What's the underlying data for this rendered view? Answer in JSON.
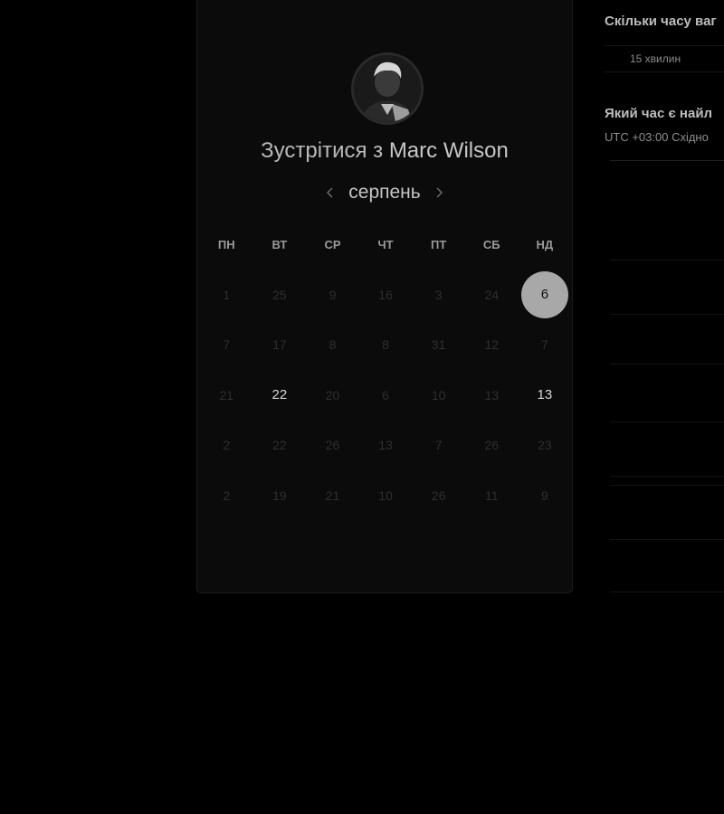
{
  "booking": {
    "title_prefix": "Зустрітися з",
    "host_name": "Marc Wilson",
    "month": "серпень"
  },
  "icons": {
    "prev": "chevron-left-icon",
    "next": "chevron-right-icon"
  },
  "weekdays": [
    "ПН",
    "ВТ",
    "СР",
    "ЧТ",
    "ПТ",
    "СБ",
    "НД"
  ],
  "days": [
    {
      "label": "1",
      "state": "disabled"
    },
    {
      "label": "25",
      "state": "disabled"
    },
    {
      "label": "9",
      "state": "disabled"
    },
    {
      "label": "16",
      "state": "disabled"
    },
    {
      "label": "3",
      "state": "disabled"
    },
    {
      "label": "24",
      "state": "disabled"
    },
    {
      "label": "6",
      "state": "selected"
    },
    {
      "label": "7",
      "state": "disabled"
    },
    {
      "label": "17",
      "state": "disabled"
    },
    {
      "label": "8",
      "state": "disabled"
    },
    {
      "label": "8",
      "state": "disabled"
    },
    {
      "label": "31",
      "state": "disabled"
    },
    {
      "label": "12",
      "state": "disabled"
    },
    {
      "label": "7",
      "state": "disabled"
    },
    {
      "label": "21",
      "state": "disabled"
    },
    {
      "label": "22",
      "state": "available"
    },
    {
      "label": "20",
      "state": "disabled"
    },
    {
      "label": "6",
      "state": "disabled"
    },
    {
      "label": "10",
      "state": "disabled"
    },
    {
      "label": "13",
      "state": "disabled"
    },
    {
      "label": "13",
      "state": "available"
    },
    {
      "label": "2",
      "state": "disabled"
    },
    {
      "label": "22",
      "state": "disabled"
    },
    {
      "label": "26",
      "state": "disabled"
    },
    {
      "label": "13",
      "state": "disabled"
    },
    {
      "label": "7",
      "state": "disabled"
    },
    {
      "label": "26",
      "state": "disabled"
    },
    {
      "label": "23",
      "state": "disabled"
    },
    {
      "label": "2",
      "state": "disabled"
    },
    {
      "label": "19",
      "state": "disabled"
    },
    {
      "label": "21",
      "state": "disabled"
    },
    {
      "label": "10",
      "state": "disabled"
    },
    {
      "label": "26",
      "state": "disabled"
    },
    {
      "label": "11",
      "state": "disabled"
    },
    {
      "label": "9",
      "state": "disabled"
    }
  ],
  "panel": {
    "duration_question": "Скільки часу ваг",
    "duration_value": "15 хвилин",
    "time_question": "Який час є найл",
    "timezone": "UTC +03:00 Східно"
  },
  "colors": {
    "background": "#000000",
    "card": "#0b0b0b",
    "selected_day": "#a8a8a8",
    "available_day": "#d8d8d8",
    "disabled_day": "#2e2e2e"
  }
}
